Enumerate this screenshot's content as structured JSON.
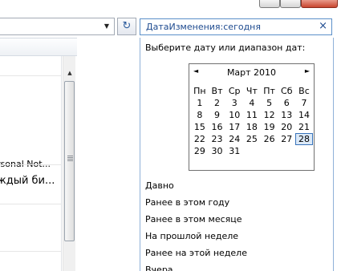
{
  "search": {
    "query": "ДатаИзменения:сегодня",
    "clear_glyph": "×"
  },
  "refresh_glyph": "↻",
  "address_dropdown_glyph": "▼",
  "left_pane": {
    "row1": "rsonal Not...",
    "row2": "ждый би...",
    "scroll_up": "▲"
  },
  "filter_panel": {
    "prompt": "Выберите дату или диапазон дат:",
    "calendar": {
      "month_label": "Март 2010",
      "prev_glyph": "◄",
      "next_glyph": "►",
      "weekday_names": [
        "Пн",
        "Вт",
        "Ср",
        "Чт",
        "Пт",
        "Сб",
        "Вс"
      ],
      "days": [
        [
          "1",
          "2",
          "3",
          "4",
          "5",
          "6",
          "7"
        ],
        [
          "8",
          "9",
          "10",
          "11",
          "12",
          "13",
          "14"
        ],
        [
          "15",
          "16",
          "17",
          "18",
          "19",
          "20",
          "21"
        ],
        [
          "22",
          "23",
          "24",
          "25",
          "26",
          "27",
          "28"
        ],
        [
          "29",
          "30",
          "31",
          "",
          "",
          "",
          ""
        ]
      ],
      "selected_day": "28"
    },
    "quick_filters": [
      "Давно",
      "Ранее в этом году",
      "Ранее в этом месяце",
      "На прошлой неделе",
      "Ранее на этой неделе",
      "Вчера"
    ]
  }
}
